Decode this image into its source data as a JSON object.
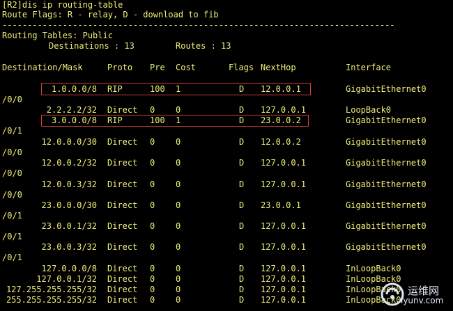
{
  "terminal": {
    "command": "[R2]dis ip routing-table",
    "flags_legend": "Route Flags: R - relay, D - download to fib",
    "separator": "------------------------------------------------------------------------------",
    "table_title": "Routing Tables: Public",
    "destinations_label": "Destinations : 13",
    "routes_label": "Routes : 13",
    "columns": {
      "destination": "Destination/Mask",
      "proto": "Proto",
      "pre": "Pre",
      "cost": "Cost",
      "flags": "Flags",
      "nexthop": "NextHop",
      "interface": "Interface"
    },
    "routes": [
      {
        "dest": "1.0.0.0/8",
        "proto": "RIP",
        "pre": "100",
        "cost": "1",
        "flags": "D",
        "nexthop": "12.0.0.1",
        "iface": "GigabitEthernet0",
        "wrap": "/0/0",
        "highlighted": true
      },
      {
        "dest": "2.2.2.2/32",
        "proto": "Direct",
        "pre": "0",
        "cost": "0",
        "flags": "D",
        "nexthop": "127.0.0.1",
        "iface": "LoopBack0",
        "wrap": "",
        "highlighted": false
      },
      {
        "dest": "3.0.0.0/8",
        "proto": "RIP",
        "pre": "100",
        "cost": "1",
        "flags": "D",
        "nexthop": "23.0.0.2",
        "iface": "GigabitEthernet0",
        "wrap": "/0/1",
        "highlighted": true
      },
      {
        "dest": "12.0.0.0/30",
        "proto": "Direct",
        "pre": "0",
        "cost": "0",
        "flags": "D",
        "nexthop": "12.0.0.2",
        "iface": "GigabitEthernet0",
        "wrap": "/0/0",
        "highlighted": false
      },
      {
        "dest": "12.0.0.2/32",
        "proto": "Direct",
        "pre": "0",
        "cost": "0",
        "flags": "D",
        "nexthop": "127.0.0.1",
        "iface": "GigabitEthernet0",
        "wrap": "/0/0",
        "highlighted": false
      },
      {
        "dest": "12.0.0.3/32",
        "proto": "Direct",
        "pre": "0",
        "cost": "0",
        "flags": "D",
        "nexthop": "127.0.0.1",
        "iface": "GigabitEthernet0",
        "wrap": "/0/0",
        "highlighted": false
      },
      {
        "dest": "23.0.0.0/30",
        "proto": "Direct",
        "pre": "0",
        "cost": "0",
        "flags": "D",
        "nexthop": "23.0.0.1",
        "iface": "GigabitEthernet0",
        "wrap": "/0/1",
        "highlighted": false
      },
      {
        "dest": "23.0.0.1/32",
        "proto": "Direct",
        "pre": "0",
        "cost": "0",
        "flags": "D",
        "nexthop": "127.0.0.1",
        "iface": "GigabitEthernet0",
        "wrap": "/0/1",
        "highlighted": false
      },
      {
        "dest": "23.0.0.3/32",
        "proto": "Direct",
        "pre": "0",
        "cost": "0",
        "flags": "D",
        "nexthop": "127.0.0.1",
        "iface": "GigabitEthernet0",
        "wrap": "/0/1",
        "highlighted": false
      },
      {
        "dest": "127.0.0.0/8",
        "proto": "Direct",
        "pre": "0",
        "cost": "0",
        "flags": "D",
        "nexthop": "127.0.0.1",
        "iface": "InLoopBack0",
        "wrap": "",
        "highlighted": false
      },
      {
        "dest": "127.0.0.1/32",
        "proto": "Direct",
        "pre": "0",
        "cost": "0",
        "flags": "D",
        "nexthop": "127.0.0.1",
        "iface": "InLoopBack0",
        "wrap": "",
        "highlighted": false
      },
      {
        "dest": "127.255.255.255/32",
        "proto": "Direct",
        "pre": "0",
        "cost": "0",
        "flags": "D",
        "nexthop": "127.0.0.1",
        "iface": "InLoopBack0",
        "wrap": "",
        "highlighted": false
      },
      {
        "dest": "255.255.255.255/32",
        "proto": "Direct",
        "pre": "0",
        "cost": "0",
        "flags": "D",
        "nexthop": "127.0.0.1",
        "iface": "InLoopBack0",
        "wrap": "",
        "highlighted": false
      }
    ]
  },
  "watermark": {
    "site_name": "运维网",
    "site_url": "iyunv.com",
    "icon": "watermark-logo-icon"
  },
  "colors": {
    "background": "#000000",
    "text": "#f0f07a",
    "highlight_border": "#d0403a"
  }
}
